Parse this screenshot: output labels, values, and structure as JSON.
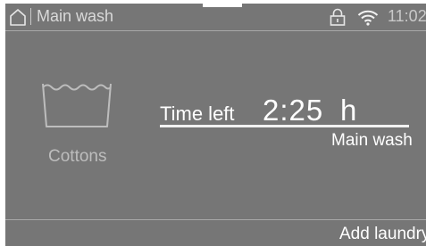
{
  "status_bar": {
    "title": "Main wash",
    "time": "11:02"
  },
  "program": {
    "name": "Cottons",
    "icon": "tub-icon"
  },
  "time_remaining": {
    "label": "Time left",
    "value": "2:25",
    "unit": "h",
    "phase": "Main wash"
  },
  "footer": {
    "add_laundry_label": "Add laundry"
  },
  "icons": [
    "home-icon",
    "lock-icon",
    "wifi-icon",
    "tub-icon"
  ],
  "colors": {
    "panel": "#767676",
    "text": "#ffffff",
    "dim_text": "#bdbdbd"
  }
}
